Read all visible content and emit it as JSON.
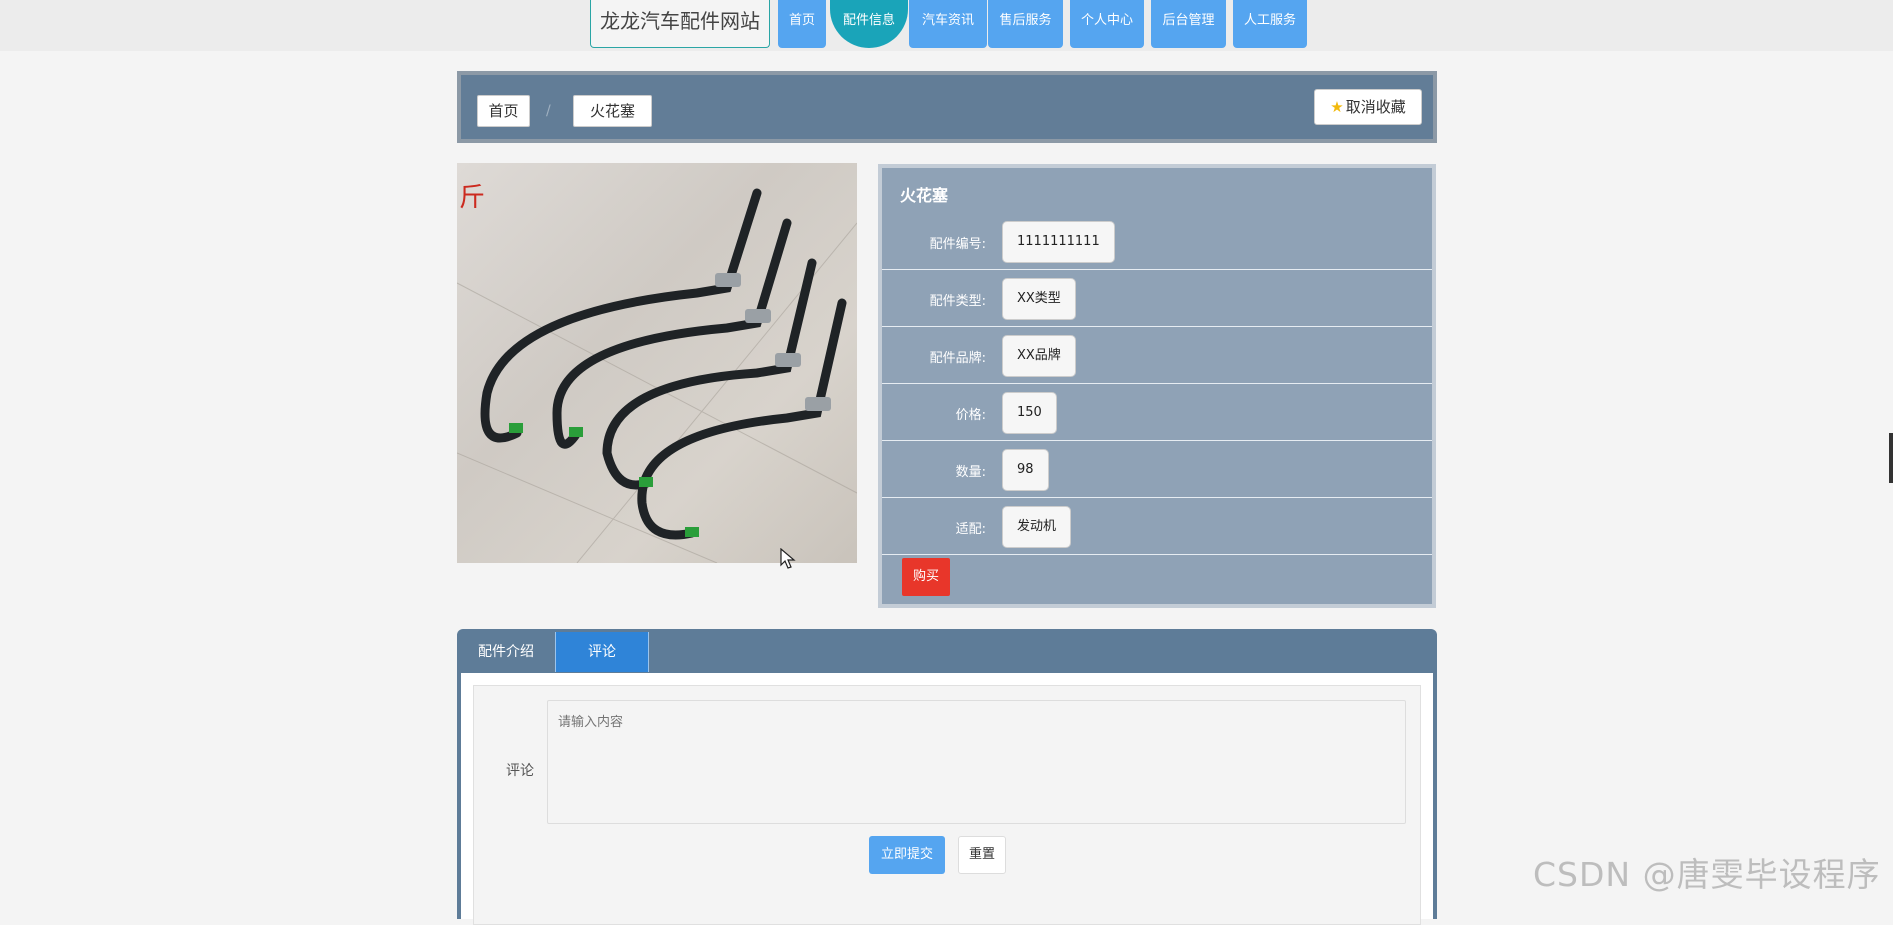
{
  "header": {
    "site_title": "龙龙汽车配件网站",
    "nav": [
      {
        "label": "首页",
        "active": false
      },
      {
        "label": "配件信息",
        "active": true
      },
      {
        "label": "汽车资讯",
        "active": false
      },
      {
        "label": "售后服务",
        "active": false
      },
      {
        "label": "个人中心",
        "active": false
      },
      {
        "label": "后台管理",
        "active": false
      },
      {
        "label": "人工服务",
        "active": false
      }
    ]
  },
  "breadcrumb": {
    "home": "首页",
    "separator": "/",
    "current": "火花塞",
    "favorite_label": "取消收藏"
  },
  "product": {
    "name": "火花塞",
    "fields": [
      {
        "label": "配件编号:",
        "value": "1111111111"
      },
      {
        "label": "配件类型:",
        "value": "XX类型"
      },
      {
        "label": "配件品牌:",
        "value": "XX品牌"
      },
      {
        "label": "价格:",
        "value": "150"
      },
      {
        "label": "数量:",
        "value": "98"
      },
      {
        "label": "适配:",
        "value": "发动机"
      }
    ],
    "buy_label": "购买",
    "image_text": "斤"
  },
  "tabs": [
    {
      "label": "配件介绍",
      "active": false
    },
    {
      "label": "评论",
      "active": true
    }
  ],
  "comment": {
    "label": "评论",
    "placeholder": "请输入内容",
    "submit_label": "立即提交",
    "reset_label": "重置"
  },
  "watermark": "CSDN @唐雯毕设程序",
  "colors": {
    "nav_blue": "#55a5f0",
    "nav_active": "#1aa4b9",
    "buy_red": "#e8362a",
    "tab_active": "#2f84d8"
  }
}
